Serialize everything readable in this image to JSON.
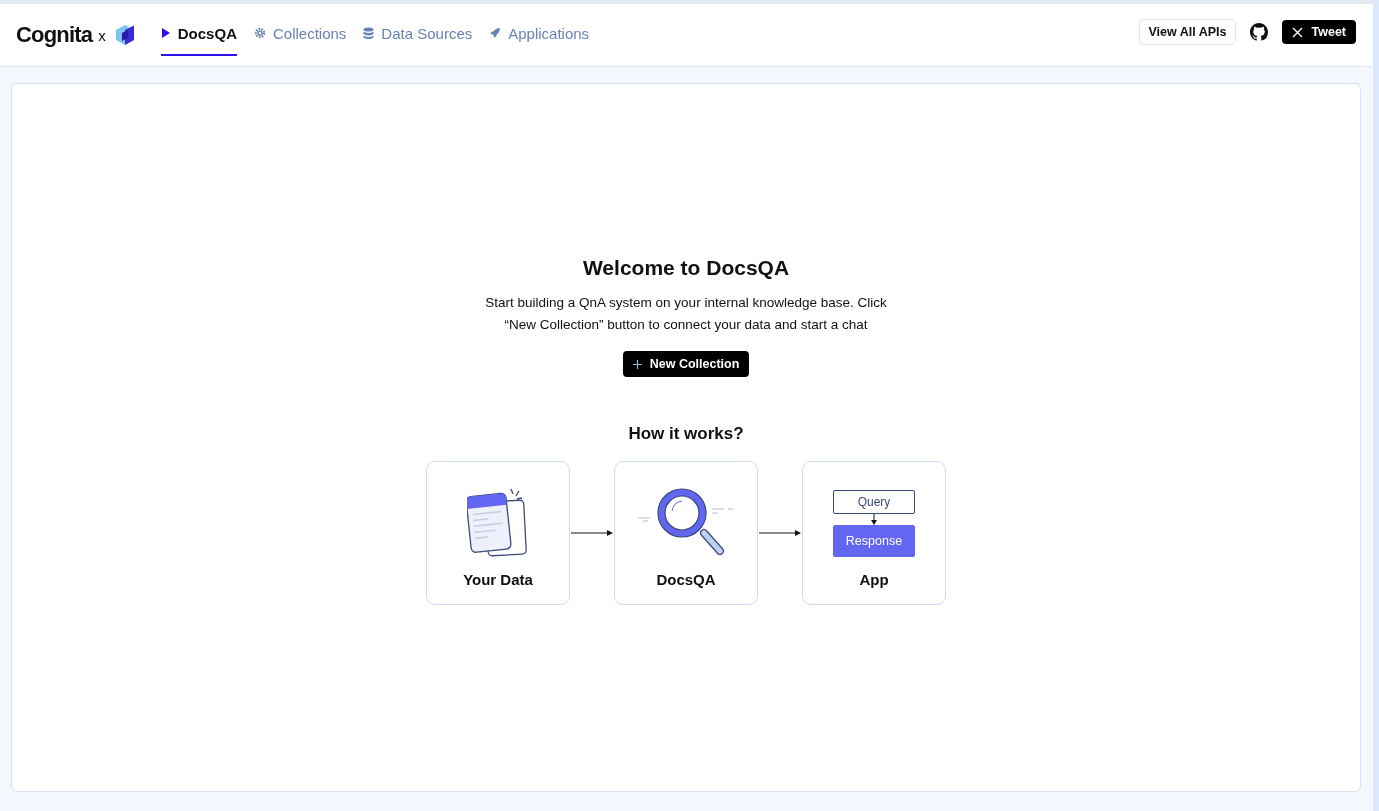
{
  "brand": {
    "name": "Cognita",
    "separator": "x"
  },
  "tabs": [
    {
      "label": "DocsQA",
      "kind": "play",
      "selected": true
    },
    {
      "label": "Collections",
      "kind": "gear",
      "selected": false
    },
    {
      "label": "Data Sources",
      "kind": "database",
      "selected": false
    },
    {
      "label": "Applications",
      "kind": "rocket",
      "selected": false
    }
  ],
  "actions": {
    "apis": "View All APIs",
    "tweet": "Tweet"
  },
  "welcome": {
    "title": "Welcome to DocsQA",
    "text": "Start building a QnA system on your internal knowledge base. Click “New Collection” button to connect your data and start a chat",
    "button": "New Collection"
  },
  "how": {
    "title": "How it works?",
    "steps": [
      {
        "kind": "data",
        "label": "Your Data"
      },
      {
        "kind": "search",
        "label": "DocsQA"
      },
      {
        "kind": "app",
        "label": "App",
        "query": "Query",
        "response": "Response"
      }
    ]
  }
}
